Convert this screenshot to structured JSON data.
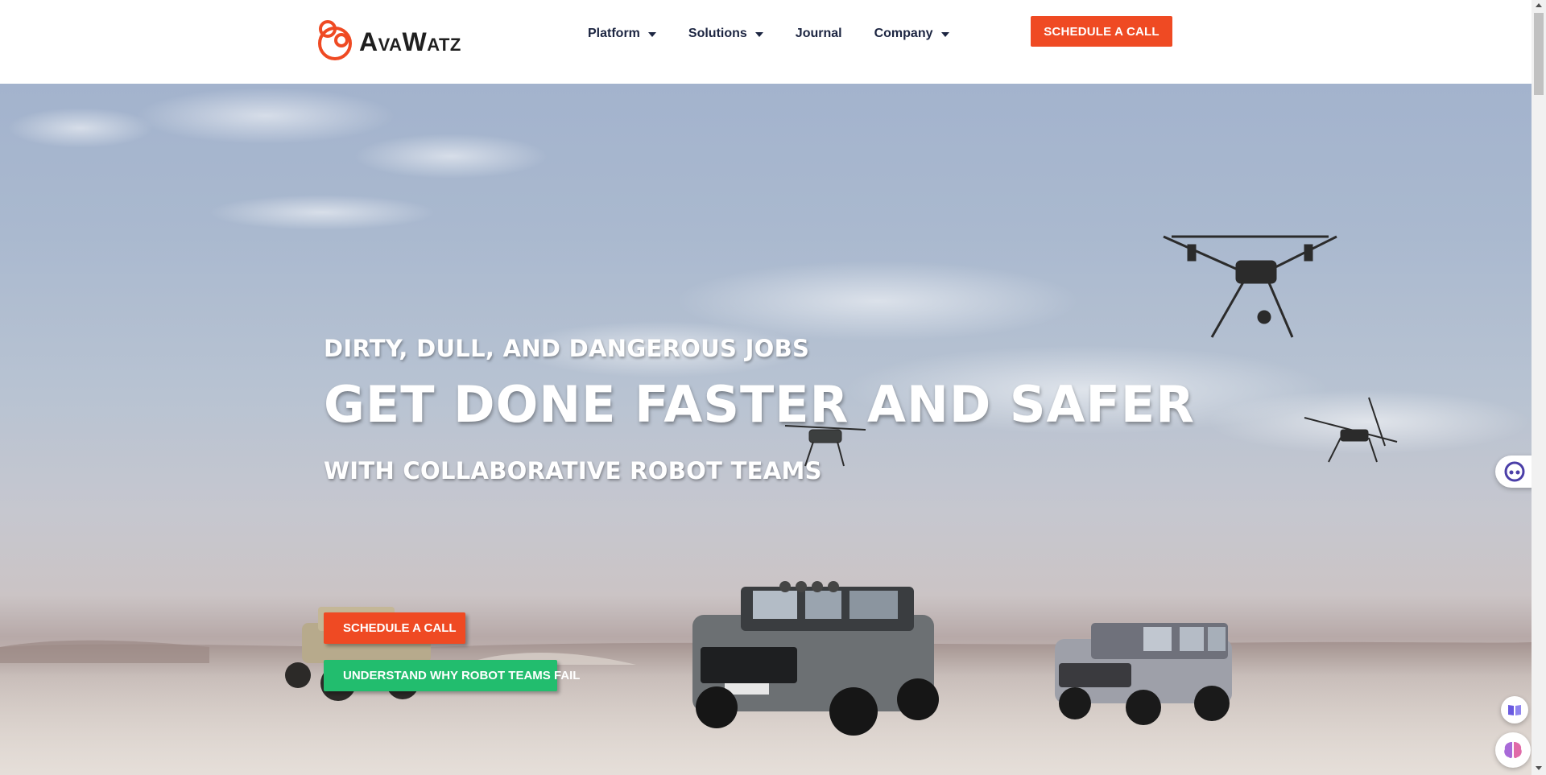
{
  "brand": {
    "name": "AvaWatz",
    "accent_color": "#ef4a23",
    "secondary_color": "#22bd6e",
    "logo_icon": "avawatz-rings-logo-icon"
  },
  "nav": {
    "items": [
      {
        "label": "Platform",
        "has_dropdown": true
      },
      {
        "label": "Solutions",
        "has_dropdown": true
      },
      {
        "label": "Journal",
        "has_dropdown": false
      },
      {
        "label": "Company",
        "has_dropdown": true
      }
    ],
    "cta_label": "SCHEDULE A CALL"
  },
  "hero": {
    "eyebrow": "DIRTY, DULL, AND DANGEROUS JOBS",
    "headline": "GET DONE FASTER AND SAFER",
    "subhead": "WITH COLLABORATIVE ROBOT TEAMS",
    "primary_button": "SCHEDULE A CALL",
    "secondary_button": "UNDERSTAND WHY ROBOT TEAMS FAIL",
    "background_description": "sky-and-desert-icon"
  },
  "widgets": {
    "chat_icon": "chat-bot-icon",
    "book_icon": "book-icon",
    "brain_icon": "brain-icon"
  }
}
